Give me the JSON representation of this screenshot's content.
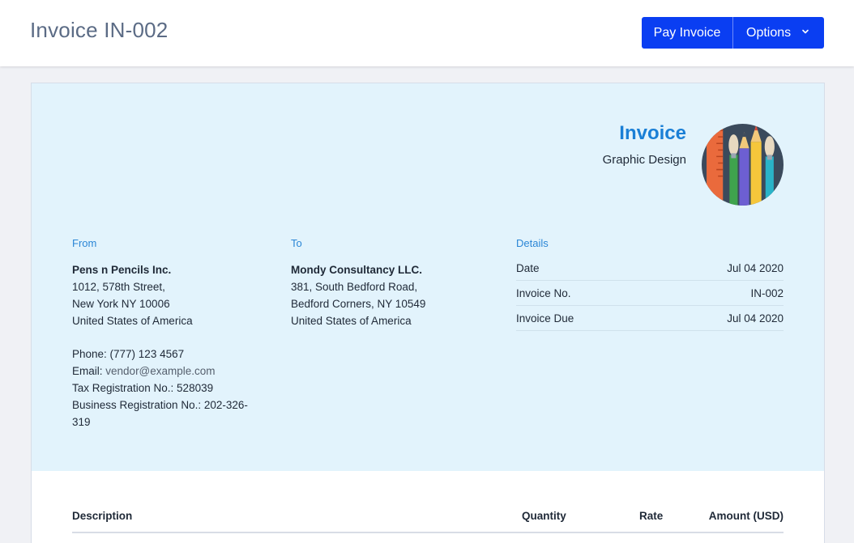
{
  "header": {
    "title": "Invoice IN-002",
    "pay_label": "Pay Invoice",
    "options_label": "Options",
    "options_icon": "chevron-down-icon",
    "accent": "#0a3ef2"
  },
  "invoice": {
    "heading": "Invoice",
    "subheading": "Graphic Design",
    "logo_icon": "pencils-brushes-logo"
  },
  "from": {
    "label": "From",
    "name": "Pens n Pencils Inc.",
    "address": [
      "1012, 578th Street,",
      "New York NY 10006",
      "United States of America"
    ],
    "phone": "Phone: (777) 123 4567",
    "email_label": "Email:",
    "email": "vendor@example.com",
    "tax": "Tax Registration No.: 528039",
    "business_line1": "Business Registration No.: 202-326-",
    "business_line2": "319"
  },
  "to": {
    "label": "To",
    "name": "Mondy Consultancy LLC.",
    "address": [
      "381, South Bedford Road,",
      "Bedford Corners, NY 10549",
      "United States of America"
    ]
  },
  "details": {
    "label": "Details",
    "rows": [
      {
        "key": "Date",
        "value": "Jul 04 2020"
      },
      {
        "key": "Invoice No.",
        "value": "IN-002"
      },
      {
        "key": "Invoice Due",
        "value": "Jul 04 2020"
      }
    ]
  },
  "items_table": {
    "columns": [
      "Description",
      "Quantity",
      "Rate",
      "Amount (USD)"
    ]
  }
}
